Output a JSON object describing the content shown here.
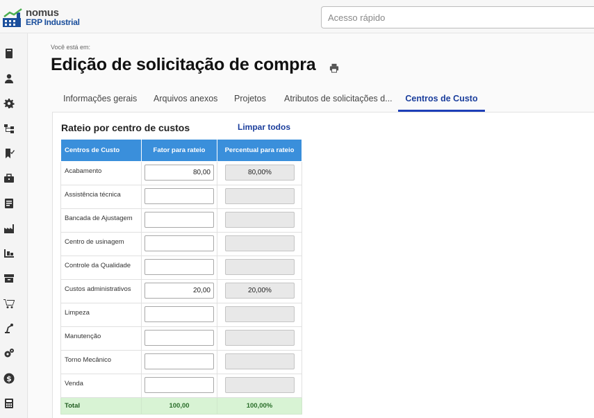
{
  "logo": {
    "name": "nomus",
    "sub": "ERP Industrial"
  },
  "search": {
    "placeholder": "Acesso rápido"
  },
  "sidebar": {
    "icons": [
      "book-icon",
      "user-icon",
      "gear-icon",
      "hierarchy-icon",
      "bookmark-check-icon",
      "briefcase-icon",
      "document-icon",
      "factory-icon",
      "pallet-icon",
      "archive-icon",
      "cart-icon",
      "robot-arm-icon",
      "gears-icon",
      "dollar-icon",
      "calculator-icon"
    ]
  },
  "breadcrumb": "Você está em:",
  "page": {
    "title": "Edição de solicitação de compra"
  },
  "tabs": [
    {
      "label": "Informações gerais",
      "active": false
    },
    {
      "label": "Arquivos anexos",
      "active": false
    },
    {
      "label": "Projetos",
      "active": false
    },
    {
      "label": "Atributos de solicitações d...",
      "active": false
    },
    {
      "label": "Centros de Custo",
      "active": true
    }
  ],
  "section": {
    "title": "Rateio por centro de custos",
    "clear_label": "Limpar todos"
  },
  "table": {
    "headers": [
      "Centros de Custo",
      "Fator para rateio",
      "Percentual para rateio"
    ],
    "rows": [
      {
        "name": "Acabamento",
        "factor": "80,00",
        "percent": "80,00%"
      },
      {
        "name": "Assistência técnica",
        "factor": "",
        "percent": ""
      },
      {
        "name": "Bancada de Ajustagem",
        "factor": "",
        "percent": ""
      },
      {
        "name": "Centro de usinagem",
        "factor": "",
        "percent": ""
      },
      {
        "name": "Controle da Qualidade",
        "factor": "",
        "percent": ""
      },
      {
        "name": "Custos administrativos",
        "factor": "20,00",
        "percent": "20,00%"
      },
      {
        "name": "Limpeza",
        "factor": "",
        "percent": ""
      },
      {
        "name": "Manutenção",
        "factor": "",
        "percent": ""
      },
      {
        "name": "Torno Mecânico",
        "factor": "",
        "percent": ""
      },
      {
        "name": "Venda",
        "factor": "",
        "percent": ""
      }
    ],
    "total": {
      "label": "Total",
      "factor": "100,00",
      "percent": "100,00%"
    }
  },
  "colors": {
    "accent": "#1d3fb8",
    "header": "#3a8fdb",
    "total_bg": "#d8f3d4"
  }
}
